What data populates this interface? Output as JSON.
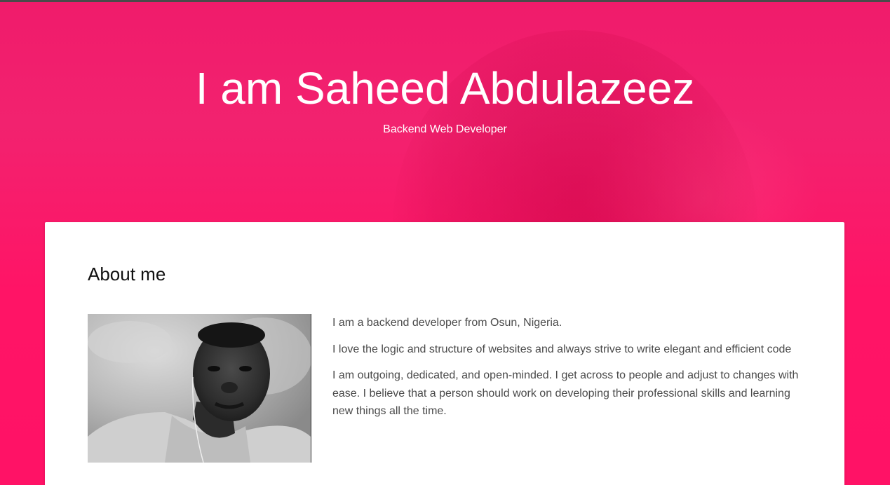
{
  "hero": {
    "title": "I am Saheed Abdulazeez",
    "subtitle": "Backend Web Developer"
  },
  "about": {
    "heading": "About me",
    "paragraphs": [
      "I am a backend developer from Osun, Nigeria.",
      "I love the logic and structure of websites and always strive to write elegant and efficient code",
      "I am outgoing, dedicated, and open-minded. I get across to people and adjust to changes with ease. I believe that a person should work on developing their professional skills and learning new things all the time."
    ]
  },
  "colors": {
    "accent": "#ff1466",
    "card_background": "#ffffff",
    "text": "#4a4a4a"
  }
}
